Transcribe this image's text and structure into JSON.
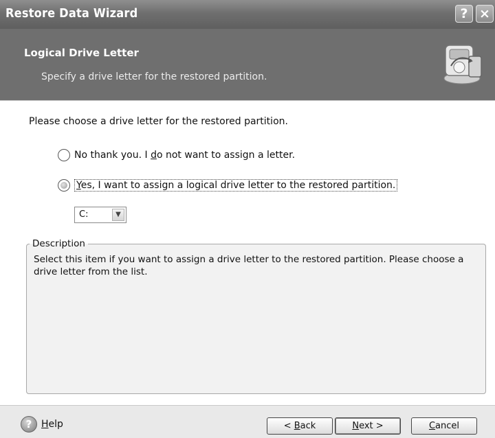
{
  "window": {
    "title": "Restore Data Wizard",
    "help_glyph": "?",
    "close_glyph": "×"
  },
  "header": {
    "heading": "Logical Drive Letter",
    "subtitle": "Specify a drive letter for the restored partition.",
    "logo_icon": "restore-wizard-icon"
  },
  "content": {
    "prompt": "Please choose a drive letter for the restored partition.",
    "options": [
      {
        "label_pre": "No thank you. I ",
        "label_u": "d",
        "label_post": "o not want to assign a letter.",
        "checked": false
      },
      {
        "label_pre": "",
        "label_u": "Y",
        "label_post": "es, I want to assign a logical drive letter to the restored partition.",
        "checked": true
      }
    ],
    "drive_select": {
      "value": "C:"
    },
    "description": {
      "legend": "Description",
      "text": "Select this item if you want to assign a drive letter to the restored partition. Please choose a drive letter from the list."
    }
  },
  "footer": {
    "help_label_u": "H",
    "help_label_rest": "elp",
    "back": {
      "pre": "< ",
      "u": "B",
      "post": "ack"
    },
    "next": {
      "pre": "",
      "u": "N",
      "post": "ext >"
    },
    "cancel": {
      "pre": "",
      "u": "C",
      "post": "ancel"
    }
  }
}
